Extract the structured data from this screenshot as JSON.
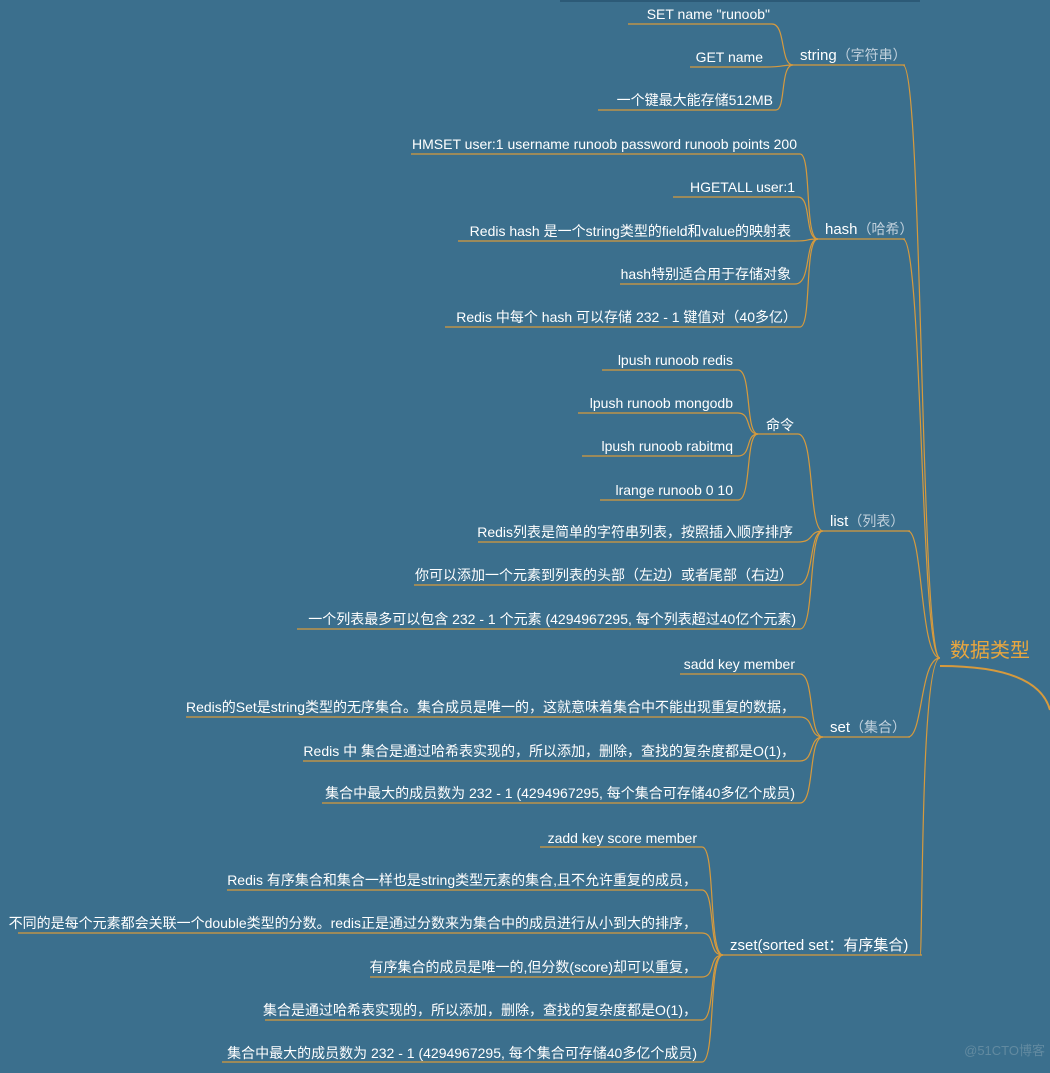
{
  "root": {
    "label": "数据类型"
  },
  "branches": {
    "string": {
      "label": "string",
      "sub": "（字符串）",
      "children": [
        "SET name \"runoob\"",
        "GET name",
        "一个键最大能存储512MB"
      ]
    },
    "hash": {
      "label": "hash",
      "sub": "（哈希）",
      "children": [
        "HMSET user:1 username runoob password runoob points 200",
        "HGETALL user:1",
        "Redis hash 是一个string类型的field和value的映射表",
        "hash特别适合用于存储对象",
        "Redis 中每个 hash 可以存储 232 - 1 键值对（40多亿）"
      ]
    },
    "list": {
      "label": "list",
      "sub": "（列表）",
      "cmdLabel": "命令",
      "commands": [
        "lpush runoob redis",
        "lpush runoob mongodb",
        "lpush runoob rabitmq",
        "lrange runoob 0 10"
      ],
      "children": [
        "Redis列表是简单的字符串列表，按照插入顺序排序",
        "你可以添加一个元素到列表的头部（左边）或者尾部（右边）",
        "一个列表最多可以包含 232 - 1 个元素 (4294967295, 每个列表超过40亿个元素)"
      ]
    },
    "set": {
      "label": "set",
      "sub": "（集合）",
      "children": [
        "sadd key member",
        "Redis的Set是string类型的无序集合。集合成员是唯一的，这就意味着集合中不能出现重复的数据，",
        "Redis 中 集合是通过哈希表实现的，所以添加，删除，查找的复杂度都是O(1)，",
        "集合中最大的成员数为 232 - 1 (4294967295, 每个集合可存储40多亿个成员)"
      ]
    },
    "zset": {
      "label": "zset(sorted set：有序集合)",
      "sub": "",
      "children": [
        "zadd key score member",
        "Redis 有序集合和集合一样也是string类型元素的集合,且不允许重复的成员，",
        "不同的是每个元素都会关联一个double类型的分数。redis正是通过分数来为集合中的成员进行从小到大的排序，",
        "有序集合的成员是唯一的,但分数(score)却可以重复，",
        "集合是通过哈希表实现的，所以添加，删除，查找的复杂度都是O(1)，",
        "集合中最大的成员数为 232 - 1 (4294967295, 每个集合可存储40多亿个成员)"
      ]
    }
  },
  "watermark": "@51CTO博客",
  "colors": {
    "line": "#d69a3d",
    "bg": "#3b6f8d"
  }
}
